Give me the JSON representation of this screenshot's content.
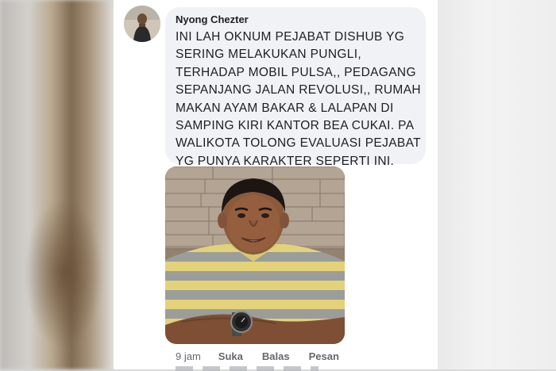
{
  "comment": {
    "author": "Nyong Chezter",
    "text": "INI LAH OKNUM PEJABAT DISHUB YG\nSERING MELAKUKAN PUNGLI,\nTERHADAP MOBIL PULSA,, PEDAGANG\nSEPANJANG JALAN REVOLUSI,, RUMAH\nMAKAN AYAM BAKAR & LALAPAN DI\nSAMPING KIRI KANTOR BEA CUKAI.  PA\nWALIKOTA TOLONG EVALUASI PEJABAT\nYG PUNYA KARAKTER SEPERTI INI.",
    "time": "9 jam",
    "actions": {
      "like": "Suka",
      "reply": "Balas",
      "message": "Pesan"
    }
  },
  "colors": {
    "bubble_bg": "#f0f2f5",
    "text": "#1c1e21",
    "meta_text": "#65676b",
    "shirt_yellow": "#e3d27a",
    "shirt_grey": "#9a9d99"
  }
}
